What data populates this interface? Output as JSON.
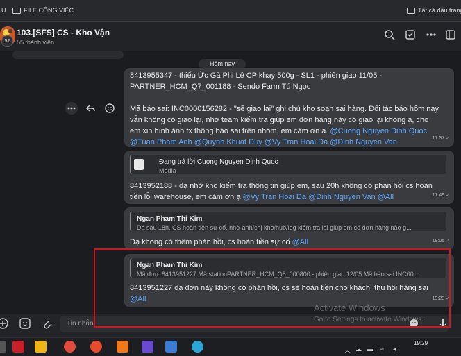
{
  "topbar": {
    "left_fragment": "U",
    "folder_label": "FILE CÔNG VIỆC",
    "right_label": "Tất cả dấu trang"
  },
  "header": {
    "avatar_badge": "52",
    "title": "103.[SFS] CS - Kho Vận",
    "members": "55 thành viên"
  },
  "date_separator": "Hôm nay",
  "messages": [
    {
      "lines": [
        "8413955347 - thiếu Ức Gà Phi Lê CP khay 500g - SL1  - phiên giao 11/05 -",
        "PARTNER_HCM_Q7_001188 - Sendo Farm Tú Ngọc",
        "",
        "Mã báo sai: INC0000156282 - \"sẽ giao lại\" ghi chú kho soạn sai hàng. Đối tác báo hôm nay",
        "vẫn không có giao lại, nhờ team kiểm tra giúp em đơn hàng này có giao lại không ạ, cho",
        "em xin hình ảnh tx thông báo sai trên nhóm, em cảm ơn ạ."
      ],
      "mention_inline": "@Cuong Nguyen Dinh Quoc",
      "mentions_line": "@Tuan Pham Anh @Quynh Khuat Duy @Vy Tran Hoai Da @Dinh Nguyen Van",
      "time": "17:37"
    },
    {
      "quote_title": "Đang trả lời Cuong Nguyen Dinh Quoc",
      "quote_sub": "Media",
      "lines": [
        "8413952188 - dạ  nhờ kho kiểm tra thông tin giúp em, sau 20h không có phản hồi cs hoàn",
        "tiền lỗi warehouse, em cảm ơn ạ"
      ],
      "mentions": "@Vy Tran Hoai Da @Dinh Nguyen Van @All",
      "time": "17:49"
    },
    {
      "quote_title": "Ngan Pham Thi Kim",
      "quote_sub": "Dạ sau 18h, CS hoàn tiền sự cố, nhờ anh/chị kho/hub/log kiểm tra lại giúp em có đơn hàng nào g...",
      "text": "Dạ không có thêm phản hồi, cs hoàn tiền sự cố",
      "mention": "@All",
      "time": "18:06"
    },
    {
      "quote_title": "Ngan Pham Thi Kim",
      "quote_sub": "Mã đơn: 8413951227 Mã stationPARTNER_HCM_Q8_000800 - phiên giao 12/05 Mã báo sai INC00...",
      "text": "8413951227 dạ đơn này không có phản hồi, cs sẽ hoàn tiền cho khách, thu hồi hàng sai",
      "mention": "@All",
      "time": "19:23"
    }
  ],
  "composer": {
    "placeholder": "Tin nhắn"
  },
  "watermark": {
    "line1": "Activate Windows",
    "line2": "Go to Settings to activate Windows."
  },
  "taskbar": {
    "time": "19:29"
  },
  "colors": {
    "background": "#1b1c1f",
    "bubble": "#3a3b3f",
    "mention": "#5aa8ff",
    "annotation_red": "#d0161c"
  },
  "icons": [
    "search-icon",
    "tasks-icon",
    "more-icon",
    "sidebar-icon",
    "more-actions-icon",
    "reply-icon",
    "emoji-icon",
    "add-icon",
    "sticker-icon",
    "attach-icon",
    "mic-icon"
  ]
}
